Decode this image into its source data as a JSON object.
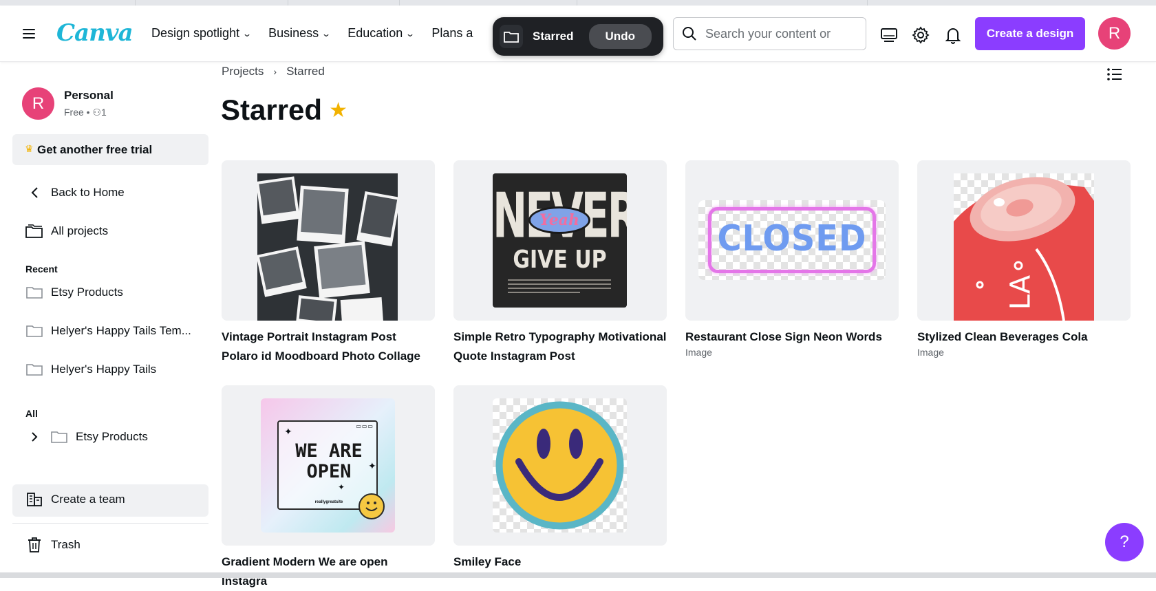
{
  "header": {
    "logo": "Canva",
    "nav": [
      {
        "label": "Design spotlight"
      },
      {
        "label": "Business"
      },
      {
        "label": "Education"
      },
      {
        "label": "Plans a"
      }
    ],
    "toast": {
      "label": "Starred",
      "undo": "Undo"
    },
    "search": {
      "placeholder": "Search your content or"
    },
    "create_button": "Create a design",
    "avatar": "R"
  },
  "sidebar": {
    "account": {
      "initial": "R",
      "name": "Personal",
      "plan": "Free • ",
      "members": "1"
    },
    "trial": "Get another free trial",
    "back": "Back to Home",
    "all_projects": "All projects",
    "recent_label": "Recent",
    "recent": [
      {
        "label": "Etsy Products"
      },
      {
        "label": "Helyer's Happy Tails Tem..."
      },
      {
        "label": "Helyer's Happy Tails"
      }
    ],
    "all_label": "All",
    "all": [
      {
        "label": "Etsy Products"
      }
    ],
    "create_team": "Create a team",
    "trash": "Trash"
  },
  "main": {
    "breadcrumb": {
      "root": "Projects",
      "current": "Starred"
    },
    "title": "Starred",
    "cards": [
      {
        "title": "Vintage Portrait Instagram Post Polaro id Moodboard Photo Collage",
        "sub": ""
      },
      {
        "title": "Simple Retro Typography Motivational  Quote Instagram Post",
        "sub": "",
        "art": {
          "line1": "NEVER",
          "badge": "Yeah",
          "line2": "GIVE UP"
        }
      },
      {
        "title": "Restaurant Close Sign Neon Words",
        "sub": "Image",
        "art": {
          "text": "CLOSED"
        }
      },
      {
        "title": "Stylized Clean Beverages Cola",
        "sub": "Image",
        "art": {
          "text": "LA"
        }
      },
      {
        "title": "Gradient Modern We are open Instagra",
        "sub": "",
        "art": {
          "line1": "WE ARE",
          "line2": "OPEN",
          "small": "reallygreatsite"
        }
      },
      {
        "title": "Smiley Face",
        "sub": ""
      }
    ]
  },
  "help": "?"
}
